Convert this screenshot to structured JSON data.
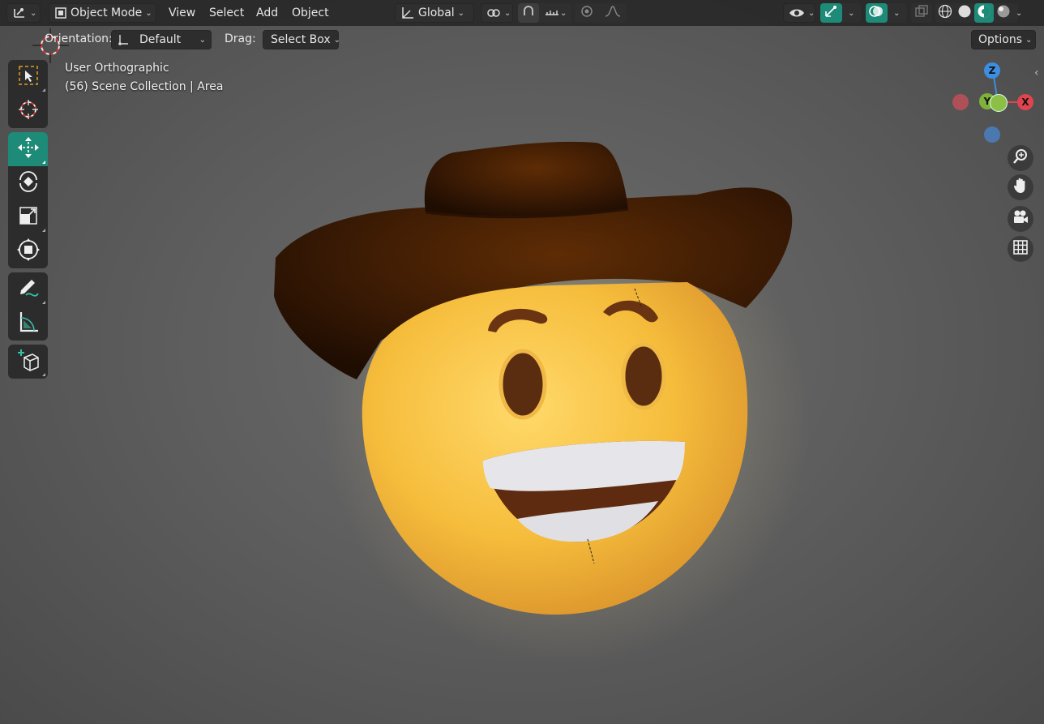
{
  "header": {
    "editor_icon": "editor-type-icon",
    "mode_label": "Object Mode",
    "menus": [
      "View",
      "Select",
      "Add",
      "Object"
    ],
    "transform_orientation": "Global",
    "snap_icon": "snap-icon",
    "proportional_icon": "proportional-edit-icon"
  },
  "tool_header": {
    "orientation_label": "Orientation:",
    "orientation_value": "Default",
    "drag_label": "Drag:",
    "drag_value": "Select Box",
    "options_label": "Options"
  },
  "viewport": {
    "view_name": "User Orthographic",
    "collection_info": "(56) Scene Collection | Area"
  },
  "gizmo": {
    "z_label": "Z",
    "y_label": "Y",
    "x_label": "X"
  },
  "toolbar": [
    "select-box",
    "cursor",
    "move",
    "rotate",
    "scale",
    "transform",
    "annotate",
    "measure",
    "add-cube"
  ],
  "colors": {
    "accent": "#1e8a78",
    "x_axis": "#e0454f",
    "y_axis": "#7fb23b",
    "z_axis": "#3d8ee0"
  }
}
